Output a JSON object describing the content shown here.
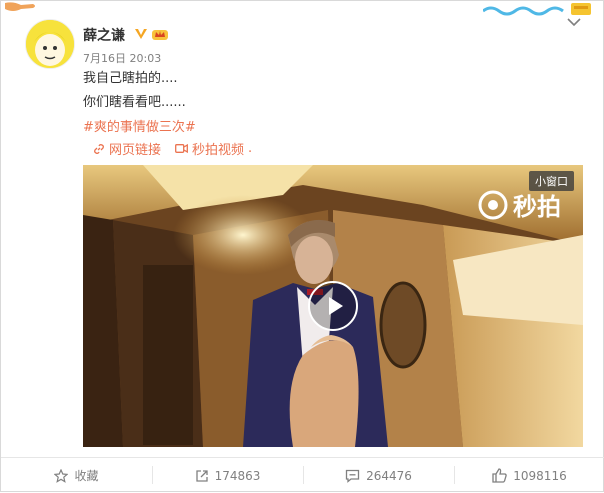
{
  "user": {
    "name": "薛之谦",
    "time": "7月16日 20:03"
  },
  "post": {
    "line1": "我自己瞎拍的....",
    "line2": "你们瞎看看吧......",
    "hashtag": "#爽的事情做三次#"
  },
  "links": {
    "web": "网页链接",
    "video": "秒拍视频",
    "dot": "."
  },
  "video": {
    "mini_window": "小窗口",
    "watermark": "秒拍"
  },
  "actions": {
    "favorite": "收藏",
    "share": "174863",
    "comment": "264476",
    "like": "1098116"
  },
  "colors": {
    "accent": "#eb7350",
    "verified": "#f5a623"
  }
}
